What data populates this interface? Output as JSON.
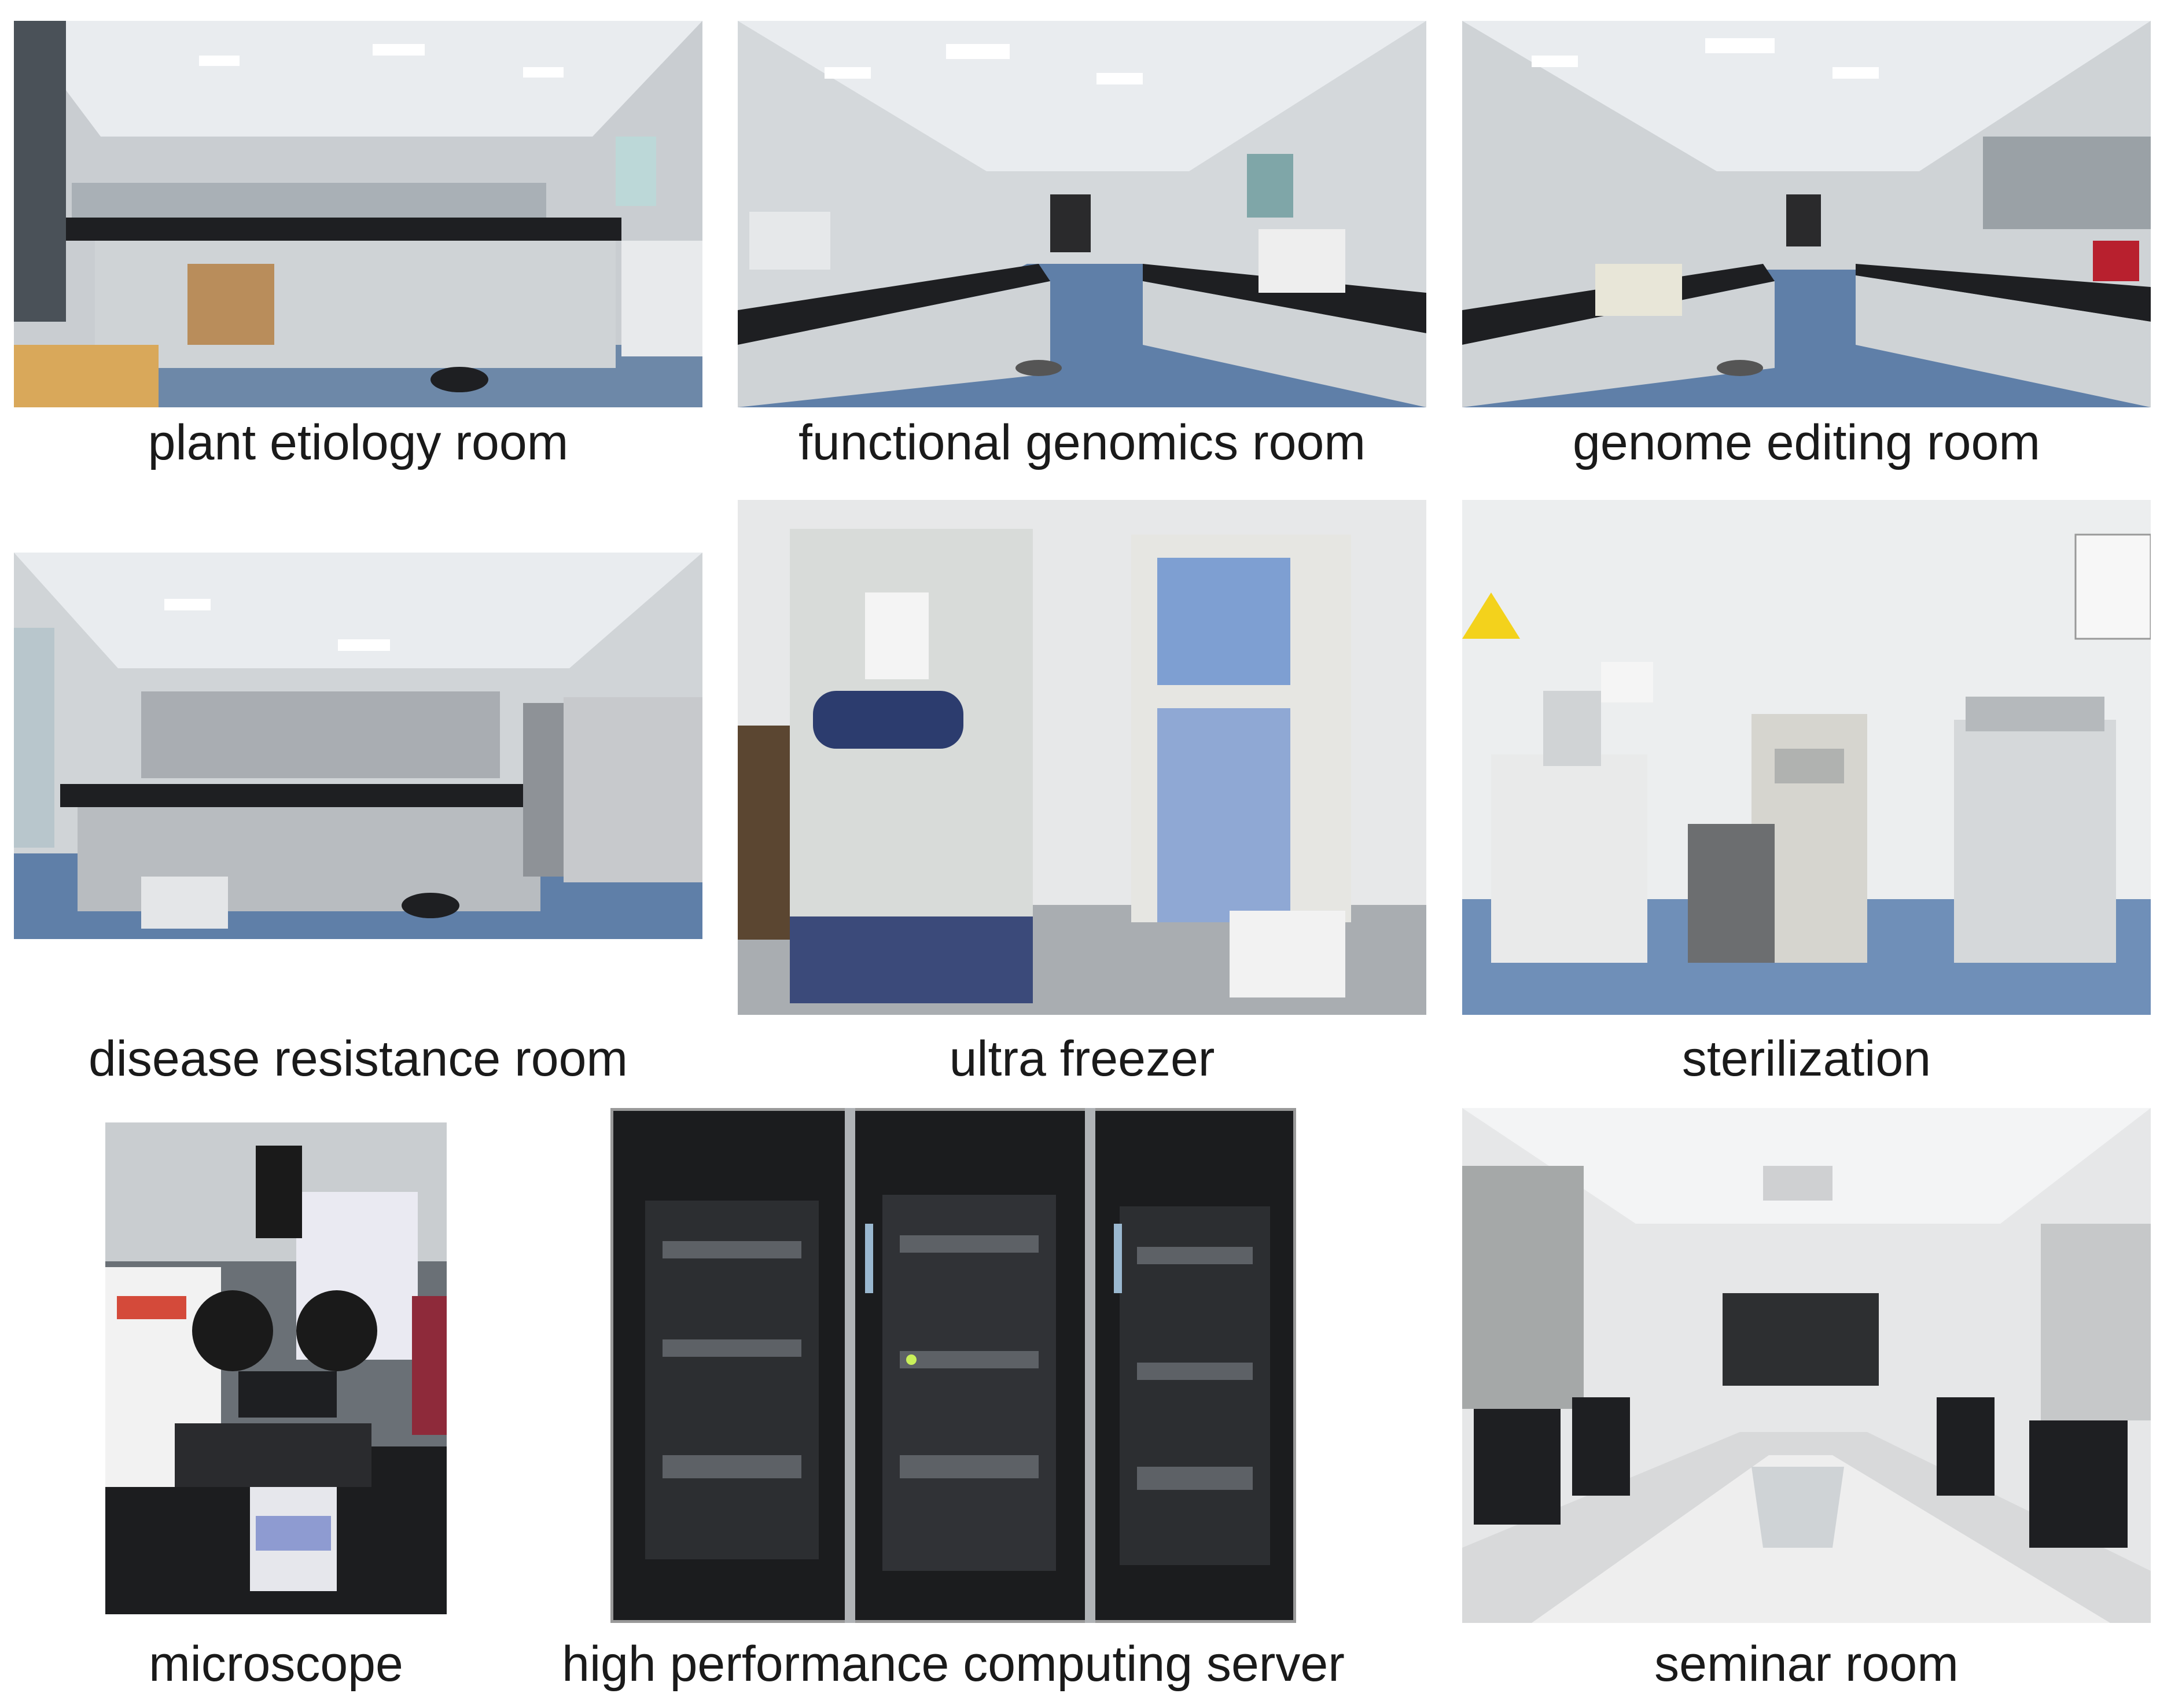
{
  "captions": {
    "plant_etiology_room": "plant etiology room",
    "functional_genomics_room": "functional genomics room",
    "genome_editing_room": "genome editing room",
    "disease_resistance_room": "disease resistance room",
    "ultra_freezer": "ultra freezer",
    "sterilization": "sterilization",
    "microscope": "microscope",
    "hpc_server": "high performance computing server",
    "seminar_room": "seminar room"
  },
  "colors": {
    "floor_blue": "#5f7fa8",
    "bench_black": "#1e1f22",
    "cabinet_grey": "#cfd3d6",
    "ceiling": "#e9ecef",
    "wall": "#dfe3e6",
    "rack_dark": "#1b1c1e"
  }
}
